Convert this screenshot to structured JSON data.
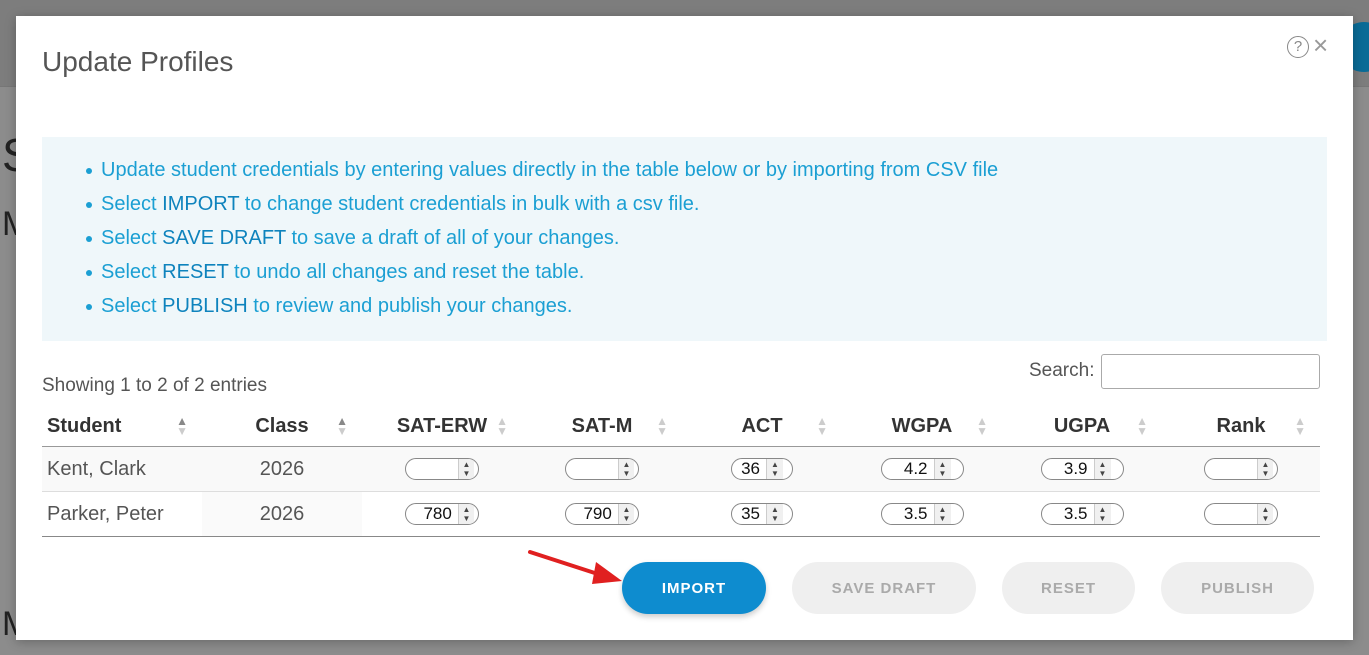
{
  "background": {
    "letter_1": "S",
    "letter_2": "M",
    "letter_3": "M"
  },
  "modal": {
    "title": "Update Profiles",
    "info_items": [
      {
        "plain_before": "Update student credentials by entering values directly in the table below or by importing from CSV file",
        "keyword": "",
        "plain_after": ""
      },
      {
        "plain_before": "Select ",
        "keyword": "IMPORT",
        "plain_after": " to change student credentials in bulk with a csv file."
      },
      {
        "plain_before": "Select ",
        "keyword": "SAVE DRAFT",
        "plain_after": " to save a draft of all of your changes."
      },
      {
        "plain_before": "Select ",
        "keyword": "RESET",
        "plain_after": " to undo all changes and reset the table."
      },
      {
        "plain_before": "Select ",
        "keyword": "PUBLISH",
        "plain_after": " to review and publish your changes."
      }
    ],
    "entries_info": "Showing 1 to 2 of 2 entries",
    "search": {
      "label": "Search:",
      "value": ""
    },
    "table": {
      "columns": [
        "Student",
        "Class",
        "SAT-ERW",
        "SAT-M",
        "ACT",
        "WGPA",
        "UGPA",
        "Rank"
      ],
      "rows": [
        {
          "student": "Kent, Clark",
          "class": "2026",
          "sat_erw": "",
          "sat_m": "",
          "act": "36",
          "wgpa": "4.2",
          "ugpa": "3.9",
          "rank": ""
        },
        {
          "student": "Parker, Peter",
          "class": "2026",
          "sat_erw": "780",
          "sat_m": "790",
          "act": "35",
          "wgpa": "3.5",
          "ugpa": "3.5",
          "rank": ""
        }
      ]
    },
    "buttons": {
      "import": "IMPORT",
      "save_draft": "SAVE DRAFT",
      "reset": "RESET",
      "publish": "PUBLISH"
    }
  },
  "colors": {
    "accent": "#0e8ccf",
    "info_text": "#1b9fd3",
    "info_bg": "#eff7fa",
    "arrow": "#e02020"
  }
}
